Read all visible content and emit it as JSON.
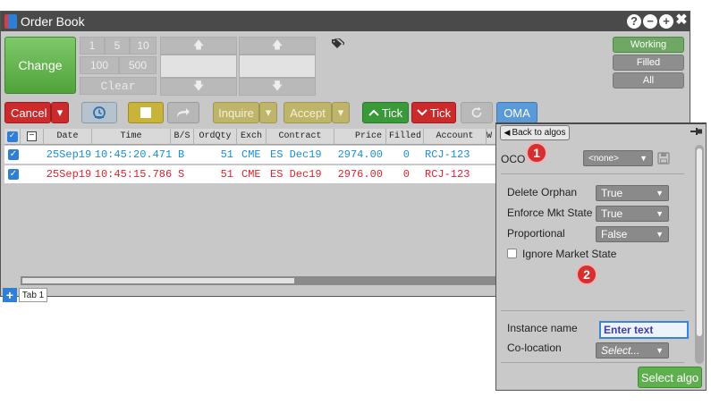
{
  "window": {
    "title": "Order Book",
    "controls": {
      "help": "?",
      "minimize": "−",
      "maximize": "+",
      "close": "✖"
    }
  },
  "order_panel": {
    "change_label": "Change",
    "qty_row1": [
      "1",
      "5",
      "10"
    ],
    "qty_row2": [
      "100",
      "500"
    ],
    "clear_label": "Clear",
    "spin_up": "🡅",
    "spin_down": "🡇",
    "status_buttons": [
      "Working",
      "Filled",
      "All"
    ]
  },
  "toolbar": {
    "cancel_label": "Cancel",
    "dropdown_caret": "▾",
    "inquire_label": "Inquire",
    "accept_label": "Accept",
    "tick_up_label": "Tick",
    "tick_down_label": "Tick",
    "oma_label": "OMA"
  },
  "grid": {
    "columns": [
      "Date",
      "Time",
      "B/S",
      "OrdQty",
      "Exch",
      "Contract",
      "Price",
      "Filled",
      "Account",
      "W"
    ],
    "rows": [
      {
        "date": "25Sep19",
        "time": "10:45:20.471",
        "side": "B",
        "qty": "51",
        "exch": "CME",
        "contract": "ES Dec19",
        "price": "2974.00",
        "filled": "0",
        "account": "RCJ-123",
        "color": "#1a8fd6"
      },
      {
        "date": "25Sep19",
        "time": "10:45:15.786",
        "side": "S",
        "qty": "51",
        "exch": "CME",
        "contract": "ES Dec19",
        "price": "2976.00",
        "filled": "0",
        "account": "RCJ-123",
        "color": "#e0242f"
      }
    ]
  },
  "tabs": {
    "add": "+",
    "items": [
      "Tab 1"
    ]
  },
  "algo_panel": {
    "back_label": "Back to algos",
    "oco_label": "OCO",
    "oco_value": "<none>",
    "callout_1": "1",
    "callout_2": "2",
    "params": [
      {
        "label": "Delete Orphan",
        "value": "True"
      },
      {
        "label": "Enforce Mkt State",
        "value": "True"
      },
      {
        "label": "Proportional",
        "value": "False"
      }
    ],
    "ignore_market_state_label": "Ignore Market State",
    "ignore_market_state_checked": false,
    "instance_name_label": "Instance name",
    "instance_name_placeholder": "Enter text",
    "colocation_label": "Co-location",
    "colocation_value": "Select...",
    "select_algo_label": "Select algo"
  }
}
